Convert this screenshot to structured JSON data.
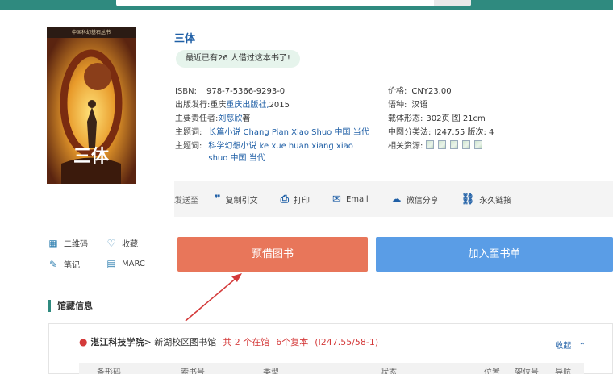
{
  "colors": {
    "accent": "#2f8a7f",
    "link": "#1f5fa6",
    "borrow_button": "#e8765a",
    "add_button": "#5a9de6",
    "alert_red": "#d43a3a"
  },
  "book": {
    "title": "三体",
    "borrow_badge": "最近已有26 人借过这本书了!",
    "cover": {
      "word": "三体",
      "top_line": "中国科幻基石丛书"
    }
  },
  "meta_left": [
    {
      "key": "ISBN:",
      "value": "978-7-5366-9293-0"
    },
    {
      "key": "出版发行:",
      "pre": "重庆 ",
      "link": "重庆出版社,",
      "post": " 2015"
    },
    {
      "key": "主要责任者:",
      "link": "刘慈欣",
      "post": " 著"
    },
    {
      "key": "主题词:",
      "link": "长篇小说 Chang Pian Xiao Shuo 中国 当代"
    },
    {
      "key": "主题词:",
      "link": "科学幻想小说 ke xue huan xiang xiao shuo 中国 当代"
    }
  ],
  "meta_right": [
    {
      "key": "价格:",
      "value": "CNY23.00"
    },
    {
      "key": "语种:",
      "value": "汉语"
    },
    {
      "key": "载体形态:",
      "value": "302页 图 21cm"
    },
    {
      "key": "中图分类法:",
      "value": "I247.55 版次: 4"
    },
    {
      "key": "相关资源:",
      "value": ""
    }
  ],
  "share": {
    "send_label": "发送至",
    "items": [
      {
        "icon": "quote-icon",
        "glyph": "❞",
        "label": "复制引文"
      },
      {
        "icon": "print-icon",
        "glyph": "⎙",
        "label": "打印"
      },
      {
        "icon": "email-icon",
        "glyph": "✉",
        "label": "Email"
      },
      {
        "icon": "wechat-icon",
        "glyph": "☁",
        "label": "微信分享"
      },
      {
        "icon": "permalink-icon",
        "glyph": "⛓",
        "label": "永久链接"
      }
    ]
  },
  "utils": {
    "qrcode": "二维码",
    "favorite": "收藏",
    "notes": "笔记",
    "marc": "MARC"
  },
  "actions": {
    "borrow": "预借图书",
    "add_to_list": "加入至书单"
  },
  "holdings": {
    "section_title": "馆藏信息",
    "library": "湛江科技学院",
    "branch": " > 新湖校区图书馆",
    "availability": "共 2 个在馆",
    "copies": "6个复本",
    "call_number": "(I247.55/58-1)",
    "collapse_label": "收起",
    "columns": [
      "条形码",
      "索书号",
      "类型",
      "状态",
      "位置",
      "架位号",
      "导航"
    ]
  }
}
